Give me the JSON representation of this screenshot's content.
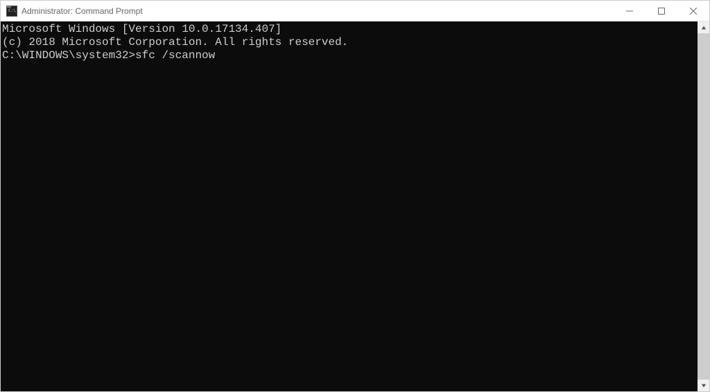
{
  "window": {
    "title": "Administrator: Command Prompt"
  },
  "terminal": {
    "line1": "Microsoft Windows [Version 10.0.17134.407]",
    "line2": "(c) 2018 Microsoft Corporation. All rights reserved.",
    "blank": "",
    "prompt": "C:\\WINDOWS\\system32>",
    "command": "sfc /scannow"
  }
}
